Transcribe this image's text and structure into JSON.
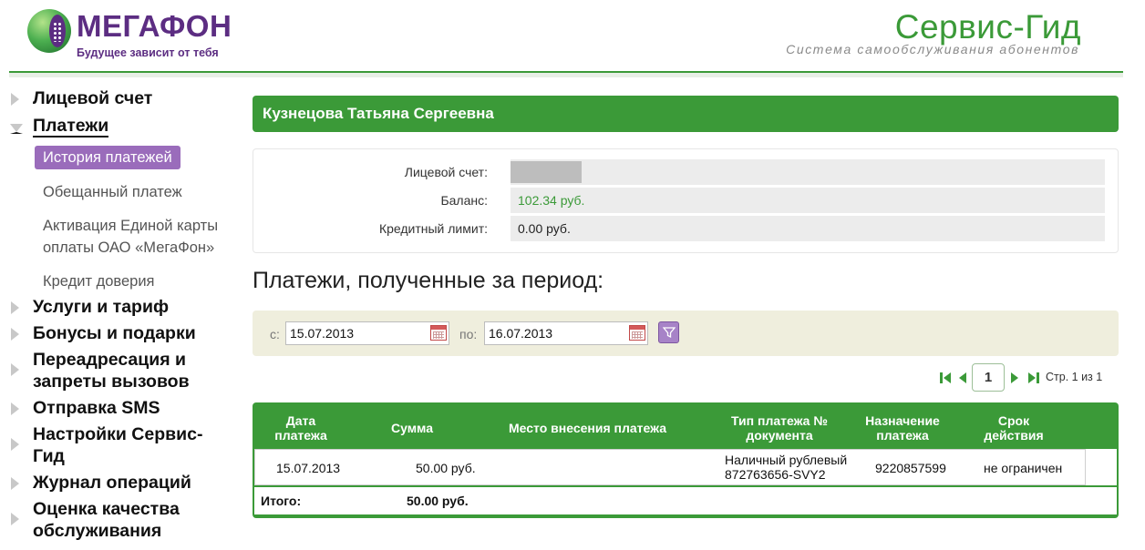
{
  "header": {
    "logo_text": "МегаФон",
    "slogan": "Будущее зависит от тебя",
    "service_title": "Сервис-Гид",
    "service_subtitle": "Система самообслуживания абонентов"
  },
  "sidebar": {
    "items": [
      {
        "label": "Лицевой счет"
      },
      {
        "label": "Платежи",
        "subitems": [
          {
            "label": "История платежей"
          },
          {
            "label": "Обещанный платеж"
          },
          {
            "label": "Активация Единой карты оплаты ОАО «МегаФон»"
          },
          {
            "label": "Кредит доверия"
          }
        ]
      },
      {
        "label": "Услуги и тариф"
      },
      {
        "label": "Бонусы и подарки"
      },
      {
        "label": "Переадресация и запреты вызовов"
      },
      {
        "label": "Отправка SMS"
      },
      {
        "label": "Настройки Сервис-Гид"
      },
      {
        "label": "Журнал операций"
      },
      {
        "label": "Оценка качества обслуживания"
      }
    ]
  },
  "user": {
    "name": "Кузнецова Татьяна Сергеевна"
  },
  "account": {
    "account_label": "Лицевой счет:",
    "balance_label": "Баланс:",
    "balance_value": "102.34 руб.",
    "credit_label": "Кредитный лимит:",
    "credit_value": "0.00 руб."
  },
  "payments": {
    "title": "Платежи, полученные за период:",
    "from_label": "с:",
    "from_value": "15.07.2013",
    "to_label": "по:",
    "to_value": "16.07.2013",
    "pager": {
      "current_page": "1",
      "page_text": "Стр. 1 из 1"
    },
    "columns": [
      "Дата платежа",
      "Сумма",
      "Место внесения платежа",
      "Тип платежа № документа",
      "Назначение платежа",
      "Срок действия"
    ],
    "rows": [
      {
        "date": "15.07.2013",
        "amount": "50.00 руб.",
        "place": "",
        "type": "Наличный рублевый 872763656-SVY2",
        "purpose": "9220857599",
        "validity": "не ограничен"
      }
    ],
    "total_label": "Итого:",
    "total_value": "50.00 руб."
  },
  "colors": {
    "brand_green": "#3b9a38",
    "brand_purple": "#5c2d82",
    "accent_lilac": "#9a6cbb"
  }
}
